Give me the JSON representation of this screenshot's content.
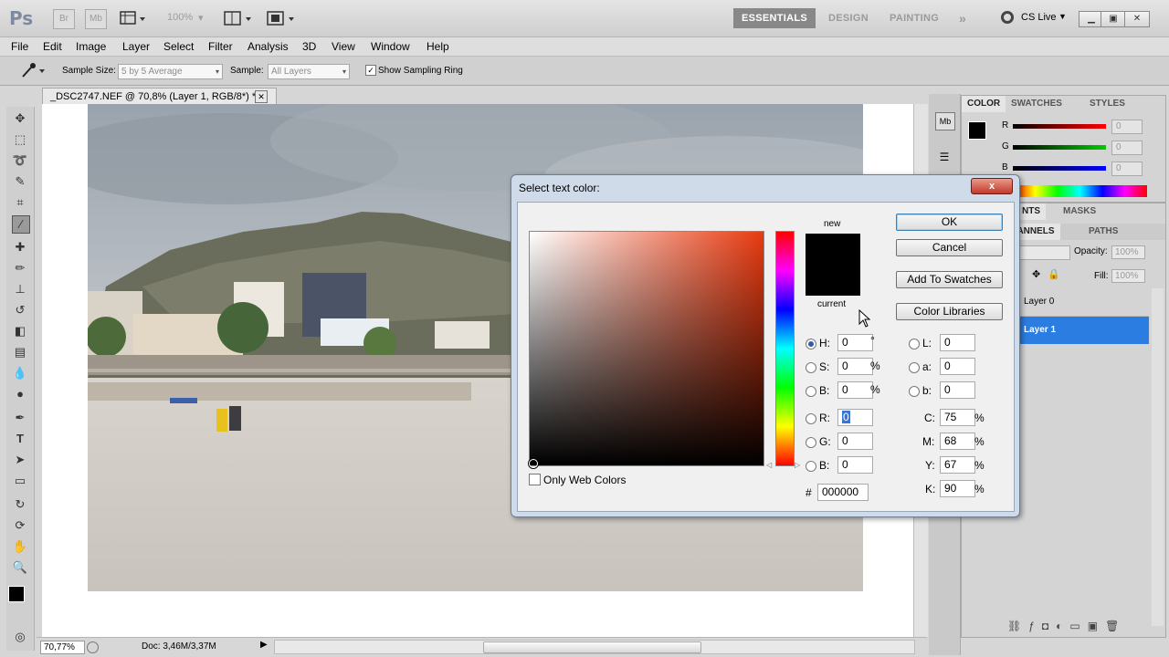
{
  "app": {
    "logo": "Ps",
    "bridge_label": "Br",
    "minibridge_label": "Mb",
    "zoom": "100%",
    "workspaces": [
      {
        "label": "ESSENTIALS",
        "active": true
      },
      {
        "label": "DESIGN",
        "active": false
      },
      {
        "label": "PAINTING",
        "active": false
      }
    ],
    "more_workspaces": "»",
    "cs_live": "CS Live"
  },
  "menu": [
    "File",
    "Edit",
    "Image",
    "Layer",
    "Select",
    "Filter",
    "Analysis",
    "3D",
    "View",
    "Window",
    "Help"
  ],
  "options": {
    "sample_size_label": "Sample Size:",
    "sample_size_value": "5 by 5 Average",
    "sample_label": "Sample:",
    "sample_value": "All Layers",
    "show_ring_label": "Show Sampling Ring",
    "show_ring_checked": true
  },
  "document": {
    "tab_title": "_DSC2747.NEF @ 70,8% (Layer 1, RGB/8*) *",
    "status_zoom": "70,77%",
    "status_doc": "Doc: 3,46M/3,37M"
  },
  "color_panel": {
    "tabs": [
      "COLOR",
      "SWATCHES",
      "STYLES"
    ],
    "r_label": "R",
    "g_label": "G",
    "b_label": "B",
    "r": "0",
    "g": "0",
    "b": "0"
  },
  "layers_panel": {
    "tab_visible": "NTS",
    "masks_tab": "MASKS",
    "channels_tab": "CHANNELS",
    "paths_tab": "PATHS",
    "opacity_label": "Opacity:",
    "opacity": "100%",
    "fill_label": "Fill:",
    "fill": "100%",
    "layers": [
      {
        "name": "Layer 0",
        "selected": false
      },
      {
        "name": "Layer 1",
        "selected": true
      }
    ]
  },
  "dialog": {
    "title": "Select text color:",
    "close_label": "x",
    "new_label": "new",
    "current_label": "current",
    "ok": "OK",
    "cancel": "Cancel",
    "add_to_swatches": "Add To Swatches",
    "color_libraries": "Color Libraries",
    "only_web_colors": "Only Web Colors",
    "hsb": [
      {
        "label": "H:",
        "value": "0",
        "unit": "°",
        "selected": true
      },
      {
        "label": "S:",
        "value": "0",
        "unit": "%",
        "selected": false
      },
      {
        "label": "B:",
        "value": "0",
        "unit": "%",
        "selected": false
      }
    ],
    "rgb": [
      {
        "label": "R:",
        "value": "0"
      },
      {
        "label": "G:",
        "value": "0"
      },
      {
        "label": "B:",
        "value": "0"
      }
    ],
    "lab": [
      {
        "label": "L:",
        "value": "0"
      },
      {
        "label": "a:",
        "value": "0"
      },
      {
        "label": "b:",
        "value": "0"
      }
    ],
    "cmyk": [
      {
        "label": "C:",
        "value": "75",
        "unit": "%"
      },
      {
        "label": "M:",
        "value": "68",
        "unit": "%"
      },
      {
        "label": "Y:",
        "value": "67",
        "unit": "%"
      },
      {
        "label": "K:",
        "value": "90",
        "unit": "%"
      }
    ],
    "hash_label": "#",
    "hex": "000000",
    "new_color": "#000000",
    "current_color": "#000000",
    "hue_color": "#e83a10"
  }
}
